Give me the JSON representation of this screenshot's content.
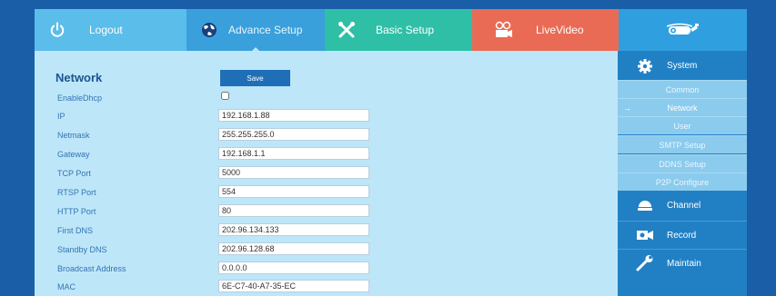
{
  "topnav": {
    "logout": {
      "label": "Logout",
      "icon": "power-icon"
    },
    "advance": {
      "label": "Advance Setup",
      "icon": "globe-icon"
    },
    "basic": {
      "label": "Basic Setup",
      "icon": "tools-icon"
    },
    "live": {
      "label": "LiveVideo",
      "icon": "video-camera-icon"
    },
    "brand": {
      "icon": "cctv-camera-logo-icon"
    }
  },
  "main": {
    "title": "Network",
    "save_label": "Save",
    "fields": [
      {
        "label": "EnableDhcp",
        "type": "checkbox",
        "checked": false
      },
      {
        "label": "IP",
        "value": "192.168.1.88"
      },
      {
        "label": "Netmask",
        "value": "255.255.255.0"
      },
      {
        "label": "Gateway",
        "value": "192.168.1.1"
      },
      {
        "label": "TCP Port",
        "value": "5000"
      },
      {
        "label": "RTSP Port",
        "value": "554"
      },
      {
        "label": "HTTP Port",
        "value": "80"
      },
      {
        "label": "First DNS",
        "value": "202.96.134.133"
      },
      {
        "label": "Standby DNS",
        "value": "202.96.128.68"
      },
      {
        "label": "Broadcast Address",
        "value": "0.0.0.0"
      },
      {
        "label": "MAC",
        "value": "6E-C7-40-A7-35-EC"
      }
    ]
  },
  "sidebar": {
    "system": {
      "label": "System",
      "icon": "gear-icon"
    },
    "items": [
      {
        "label": "Common"
      },
      {
        "label": "Network",
        "active": true,
        "arrow": "→"
      },
      {
        "label": "User"
      },
      {
        "label": "SMTP Setup"
      },
      {
        "label": "DDNS Setup"
      },
      {
        "label": "P2P Configure"
      }
    ],
    "channel": {
      "label": "Channel",
      "icon": "dome-camera-icon"
    },
    "record": {
      "label": "Record",
      "icon": "record-camera-icon"
    },
    "maintain": {
      "label": "Maintain",
      "icon": "wrench-icon"
    }
  },
  "colors": {
    "background": "#1a5ea8",
    "logout_tab": "#5bbde9",
    "advance_tab": "#39a0dc",
    "basic_tab": "#2fbfa7",
    "live_tab": "#ea6b55",
    "brand_tab": "#2f9fe0",
    "content_bg": "#bde6f8",
    "sidebar_bg": "#2180c4",
    "sidebar_sub_bg": "#8bcbee",
    "save_button": "#1f6fb8",
    "label_text": "#3474b4",
    "title_text": "#1b5590"
  }
}
